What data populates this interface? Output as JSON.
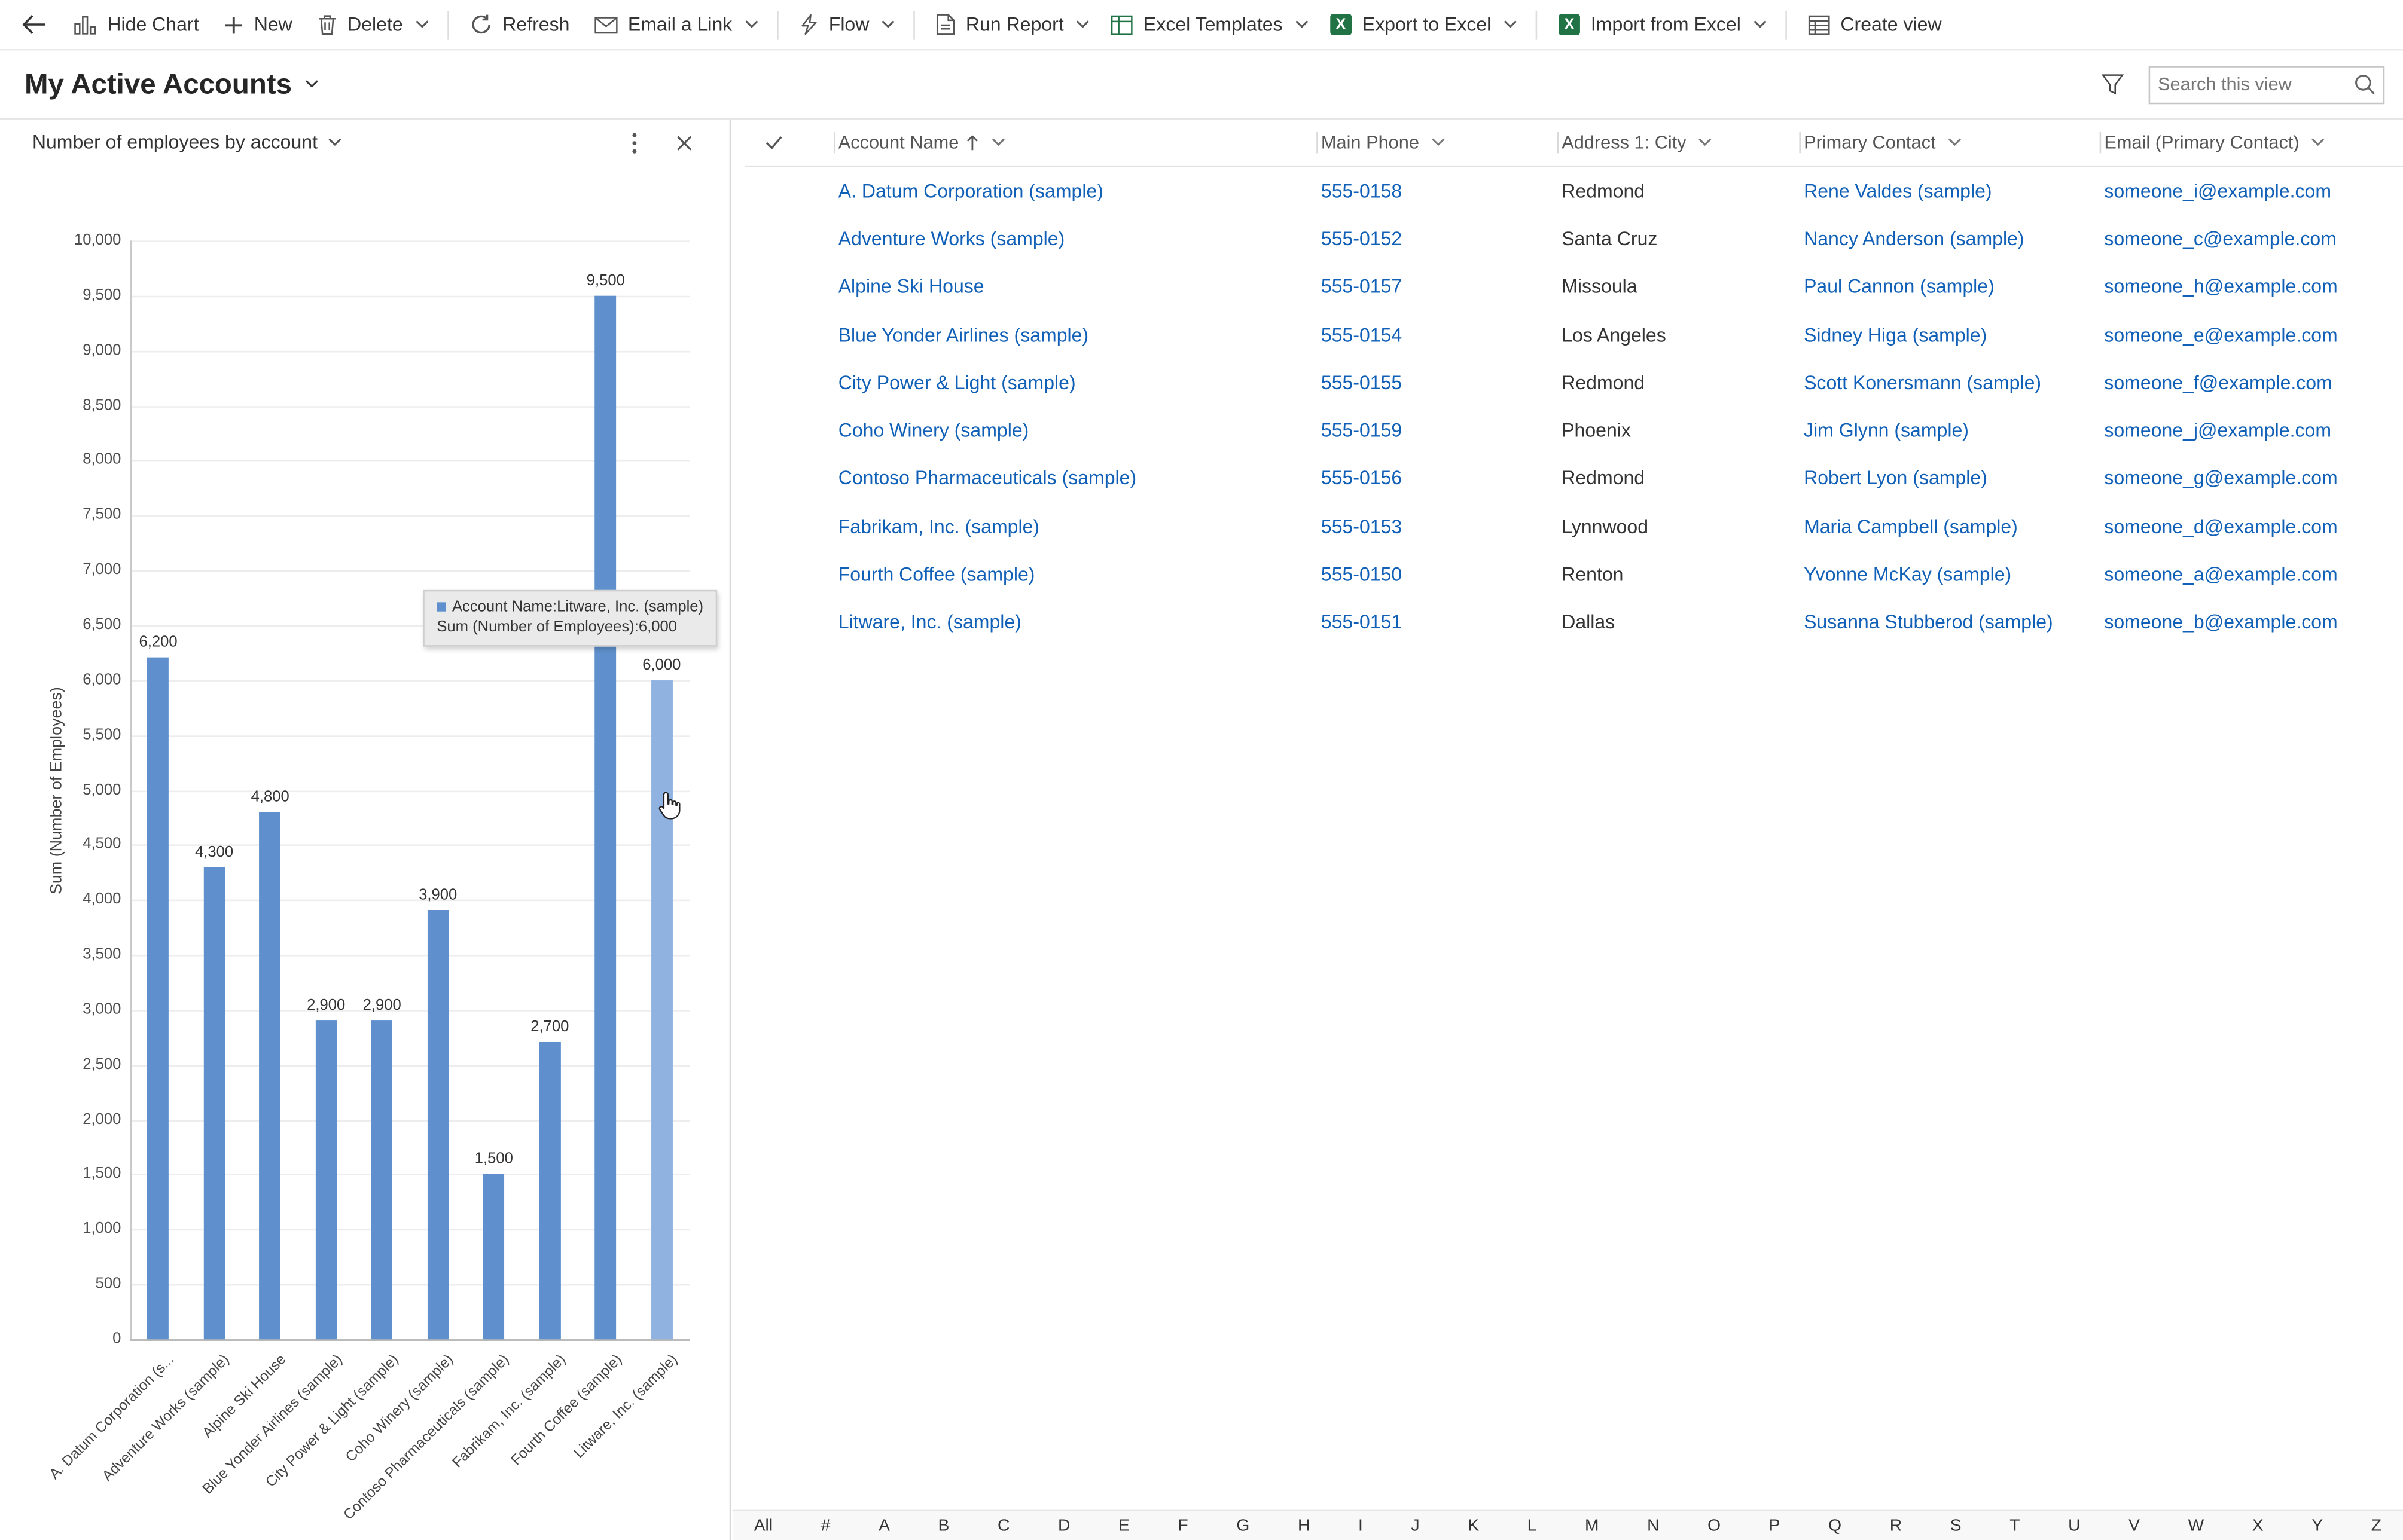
{
  "colors": {
    "link": "#1160b7",
    "bar": "#5f90cd",
    "bar_highlight": "#8fb2e0",
    "excel_green": "#217346"
  },
  "toolbar": {
    "items": [
      {
        "label": "Hide Chart",
        "icon": "hide-chart",
        "chevron": false,
        "divider": false
      },
      {
        "label": "New",
        "icon": "plus",
        "chevron": false,
        "divider": false
      },
      {
        "label": "Delete",
        "icon": "trash",
        "chevron": true,
        "divider": true
      },
      {
        "label": "Refresh",
        "icon": "refresh",
        "chevron": false,
        "divider": false
      },
      {
        "label": "Email a Link",
        "icon": "email",
        "chevron": true,
        "divider": true
      },
      {
        "label": "Flow",
        "icon": "flow",
        "chevron": true,
        "divider": true
      },
      {
        "label": "Run Report",
        "icon": "report",
        "chevron": true,
        "divider": false
      },
      {
        "label": "Excel Templates",
        "icon": "excel-templates",
        "chevron": true,
        "divider": false
      },
      {
        "label": "Export to Excel",
        "icon": "excel",
        "chevron": true,
        "divider": true
      },
      {
        "label": "Import from Excel",
        "icon": "excel",
        "chevron": true,
        "divider": true
      },
      {
        "label": "Create view",
        "icon": "create-view",
        "chevron": false,
        "divider": false
      }
    ]
  },
  "view": {
    "title": "My Active Accounts",
    "search_placeholder": "Search this view"
  },
  "chart": {
    "panel_title": "Number of employees by account",
    "tooltip_line1": "Account Name:Litware, Inc. (sample)",
    "tooltip_line2": "Sum (Number of Employees):6,000"
  },
  "chart_data": {
    "type": "bar",
    "title": "Number of employees by account",
    "xlabel": "",
    "ylabel": "Sum (Number of Employees)",
    "ylim": [
      0,
      10000
    ],
    "ytick_step": 500,
    "grid": true,
    "legend_position": "none",
    "categories": [
      "A. Datum Corporation (s...",
      "Adventure Works (sample)",
      "Alpine Ski House",
      "Blue Yonder Airlines (sample)",
      "City Power & Light (sample)",
      "Coho Winery (sample)",
      "Contoso Pharmaceuticals (sample)",
      "Fabrikam, Inc. (sample)",
      "Fourth Coffee (sample)",
      "Litware, Inc. (sample)"
    ],
    "values": [
      6200,
      4300,
      4800,
      2900,
      2900,
      3900,
      1500,
      2700,
      9500,
      6000
    ],
    "highlighted_index": 9
  },
  "grid": {
    "columns": [
      {
        "label": "Account Name",
        "sorted": "asc"
      },
      {
        "label": "Main Phone",
        "sorted": ""
      },
      {
        "label": "Address 1: City",
        "sorted": ""
      },
      {
        "label": "Primary Contact",
        "sorted": ""
      },
      {
        "label": "Email (Primary Contact)",
        "sorted": ""
      }
    ],
    "rows": [
      {
        "account": "A. Datum Corporation (sample)",
        "phone": "555-0158",
        "city": "Redmond",
        "contact": "Rene Valdes (sample)",
        "email": "someone_i@example.com"
      },
      {
        "account": "Adventure Works (sample)",
        "phone": "555-0152",
        "city": "Santa Cruz",
        "contact": "Nancy Anderson (sample)",
        "email": "someone_c@example.com"
      },
      {
        "account": "Alpine Ski House",
        "phone": "555-0157",
        "city": "Missoula",
        "contact": "Paul Cannon (sample)",
        "email": "someone_h@example.com"
      },
      {
        "account": "Blue Yonder Airlines (sample)",
        "phone": "555-0154",
        "city": "Los Angeles",
        "contact": "Sidney Higa (sample)",
        "email": "someone_e@example.com"
      },
      {
        "account": "City Power & Light (sample)",
        "phone": "555-0155",
        "city": "Redmond",
        "contact": "Scott Konersmann (sample)",
        "email": "someone_f@example.com"
      },
      {
        "account": "Coho Winery (sample)",
        "phone": "555-0159",
        "city": "Phoenix",
        "contact": "Jim Glynn (sample)",
        "email": "someone_j@example.com"
      },
      {
        "account": "Contoso Pharmaceuticals (sample)",
        "phone": "555-0156",
        "city": "Redmond",
        "contact": "Robert Lyon (sample)",
        "email": "someone_g@example.com"
      },
      {
        "account": "Fabrikam, Inc. (sample)",
        "phone": "555-0153",
        "city": "Lynnwood",
        "contact": "Maria Campbell (sample)",
        "email": "someone_d@example.com"
      },
      {
        "account": "Fourth Coffee (sample)",
        "phone": "555-0150",
        "city": "Renton",
        "contact": "Yvonne McKay (sample)",
        "email": "someone_a@example.com"
      },
      {
        "account": "Litware, Inc. (sample)",
        "phone": "555-0151",
        "city": "Dallas",
        "contact": "Susanna Stubberod (sample)",
        "email": "someone_b@example.com"
      }
    ]
  },
  "jumpbar": {
    "items": [
      "All",
      "#",
      "A",
      "B",
      "C",
      "D",
      "E",
      "F",
      "G",
      "H",
      "I",
      "J",
      "K",
      "L",
      "M",
      "N",
      "O",
      "P",
      "Q",
      "R",
      "S",
      "T",
      "U",
      "V",
      "W",
      "X",
      "Y",
      "Z"
    ]
  }
}
